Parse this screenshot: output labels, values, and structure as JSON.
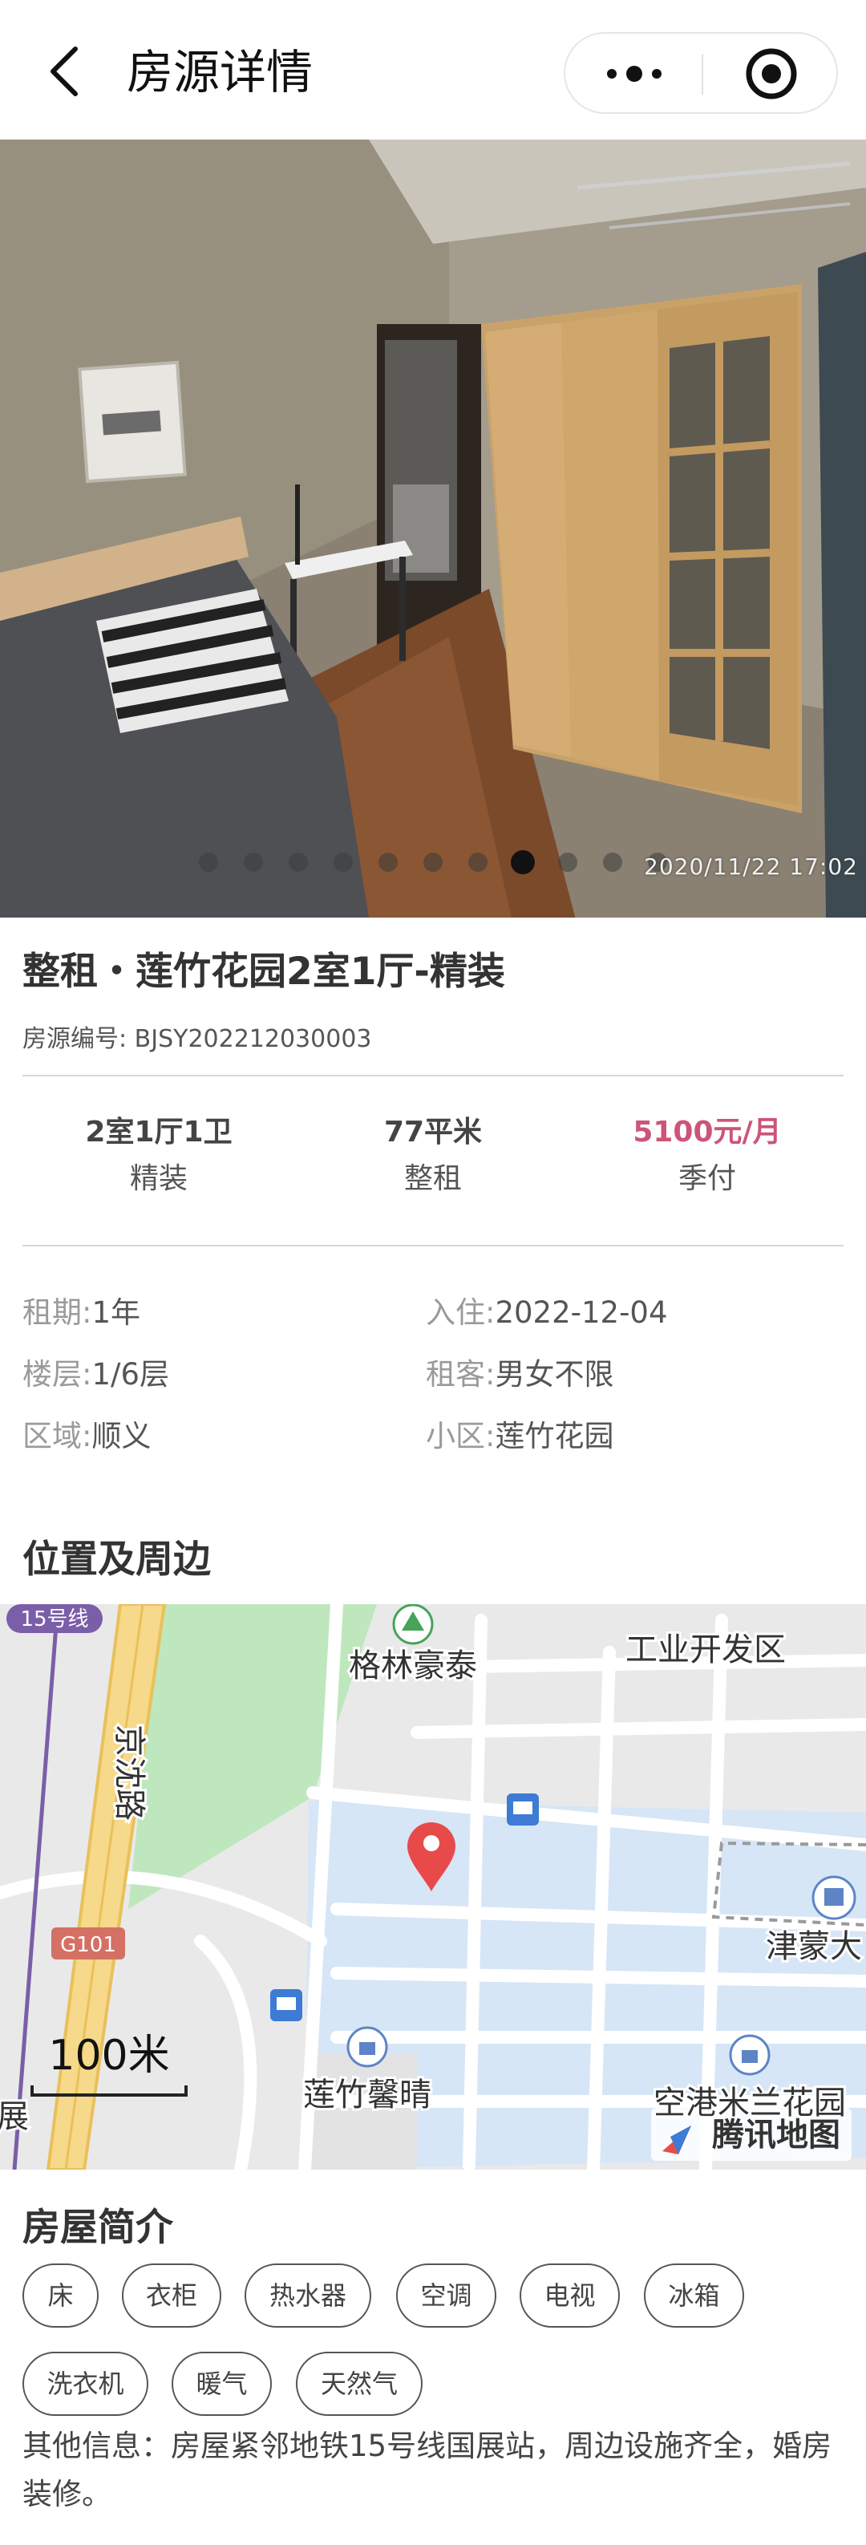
{
  "header": {
    "title": "房源详情"
  },
  "photo": {
    "timestamp": "2020/11/22 17:02",
    "slide_count": 11,
    "active_slide": 8
  },
  "listing": {
    "title": "整租・莲竹花园2室1厅-精装",
    "id_label": "房源编号:",
    "id_value": "BJSY202212030003"
  },
  "stats": [
    {
      "main": "2室1厅1卫",
      "sub": "精装"
    },
    {
      "main": "77平米",
      "sub": "整租"
    },
    {
      "main": "5100元/月",
      "sub": "季付"
    }
  ],
  "details": {
    "lease_term": {
      "label": "租期:",
      "value": "1年"
    },
    "move_in": {
      "label": "入住:",
      "value": "2022-12-04"
    },
    "floor": {
      "label": "楼层:",
      "value": "1/6层"
    },
    "tenant": {
      "label": "租客:",
      "value": "男女不限"
    },
    "district": {
      "label": "区域:",
      "value": "顺义"
    },
    "community": {
      "label": "小区:",
      "value": "莲竹花园"
    }
  },
  "location": {
    "section_title": "位置及周边",
    "map_labels": {
      "line15": "15号线",
      "road": "京沈路",
      "g101": "G101",
      "glhr": "格林豪泰",
      "industrial": "工业开发区",
      "jinmeng": "津蒙大",
      "lzxq": "莲竹馨晴",
      "kongang": "空港米兰花园",
      "zhan": "展",
      "scale": "100米",
      "brand": "腾讯地图"
    }
  },
  "intro": {
    "section_title": "房屋简介",
    "tags": [
      "床",
      "衣柜",
      "热水器",
      "空调",
      "电视",
      "冰箱",
      "洗衣机",
      "暖气",
      "天然气"
    ],
    "other_info": "其他信息：房屋紧邻地铁15号线国展站，周边设施齐全，婚房装修。"
  },
  "colors": {
    "price": "#cc5577",
    "map_marker": "#e84a4a"
  }
}
